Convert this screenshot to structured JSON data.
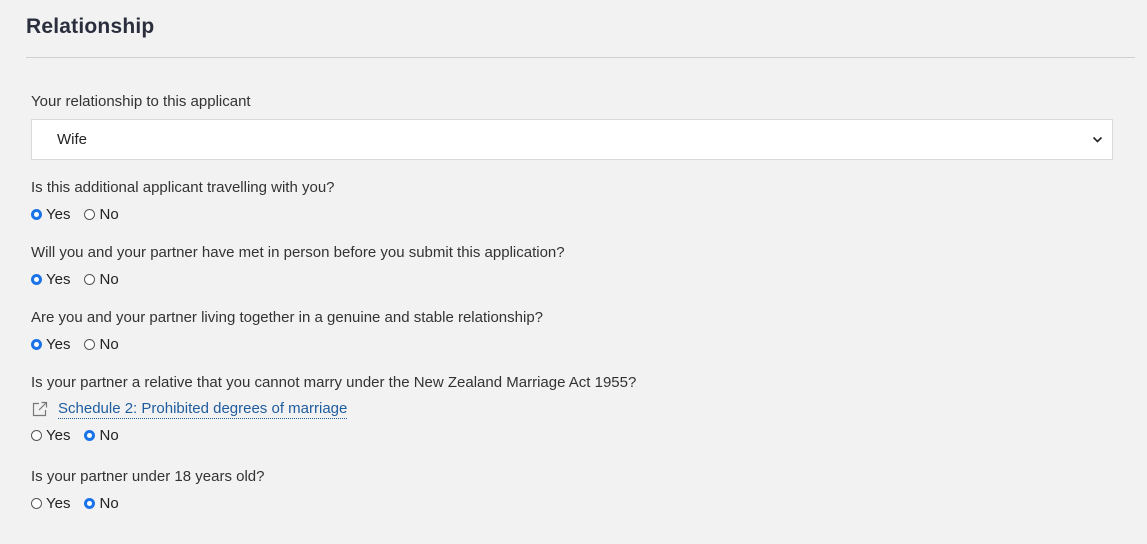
{
  "section": {
    "title": "Relationship"
  },
  "relationship": {
    "label": "Your relationship to this applicant",
    "selected": "Wife"
  },
  "questions": [
    {
      "label": "Is this additional applicant travelling with you?",
      "yes": "Yes",
      "no": "No",
      "answer": "Yes"
    },
    {
      "label": "Will you and your partner have met in person before you submit this application?",
      "yes": "Yes",
      "no": "No",
      "answer": "Yes"
    },
    {
      "label": "Are you and your partner living together in a genuine and stable relationship?",
      "yes": "Yes",
      "no": "No",
      "answer": "Yes"
    },
    {
      "label": "Is your partner a relative that you cannot marry under the New Zealand Marriage Act 1955?",
      "link": "Schedule 2: Prohibited degrees of marriage",
      "yes": "Yes",
      "no": "No",
      "answer": "No"
    },
    {
      "label": "Is your partner under 18 years old?",
      "yes": "Yes",
      "no": "No",
      "answer": "No"
    }
  ],
  "icons": {
    "external_link": "external-link-icon",
    "chevron": "chevron-down-icon"
  },
  "colors": {
    "radio_checked": "#1a73e8",
    "link": "#1f5c9e",
    "title": "#2a2e3d"
  }
}
